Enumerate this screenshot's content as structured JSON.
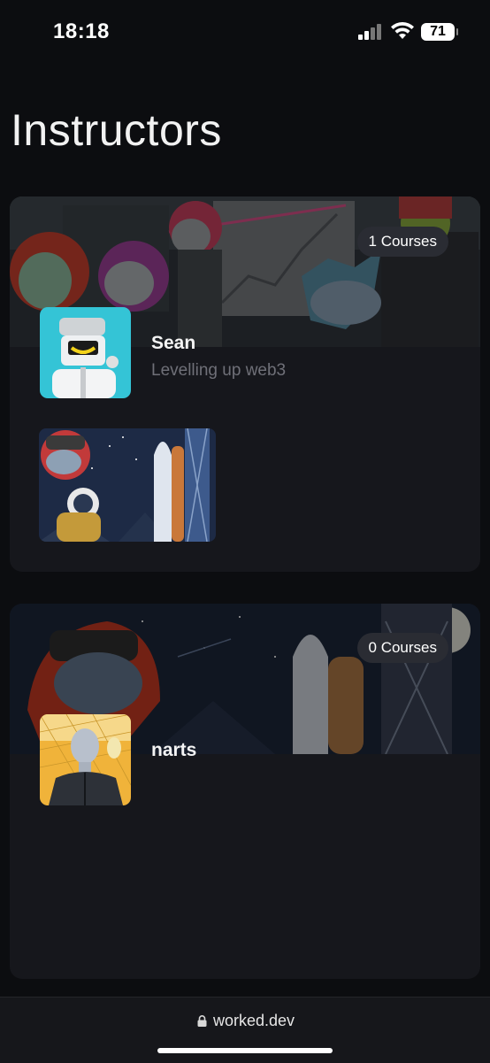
{
  "status_bar": {
    "time": "18:18",
    "battery": "71"
  },
  "page": {
    "title": "Instructors"
  },
  "instructors": [
    {
      "name": "Sean",
      "description": "Levelling up web3",
      "courses_badge": "1 Courses"
    },
    {
      "name": "narts",
      "description": "",
      "courses_badge": "0 Courses"
    }
  ],
  "browser": {
    "url": "worked.dev"
  }
}
